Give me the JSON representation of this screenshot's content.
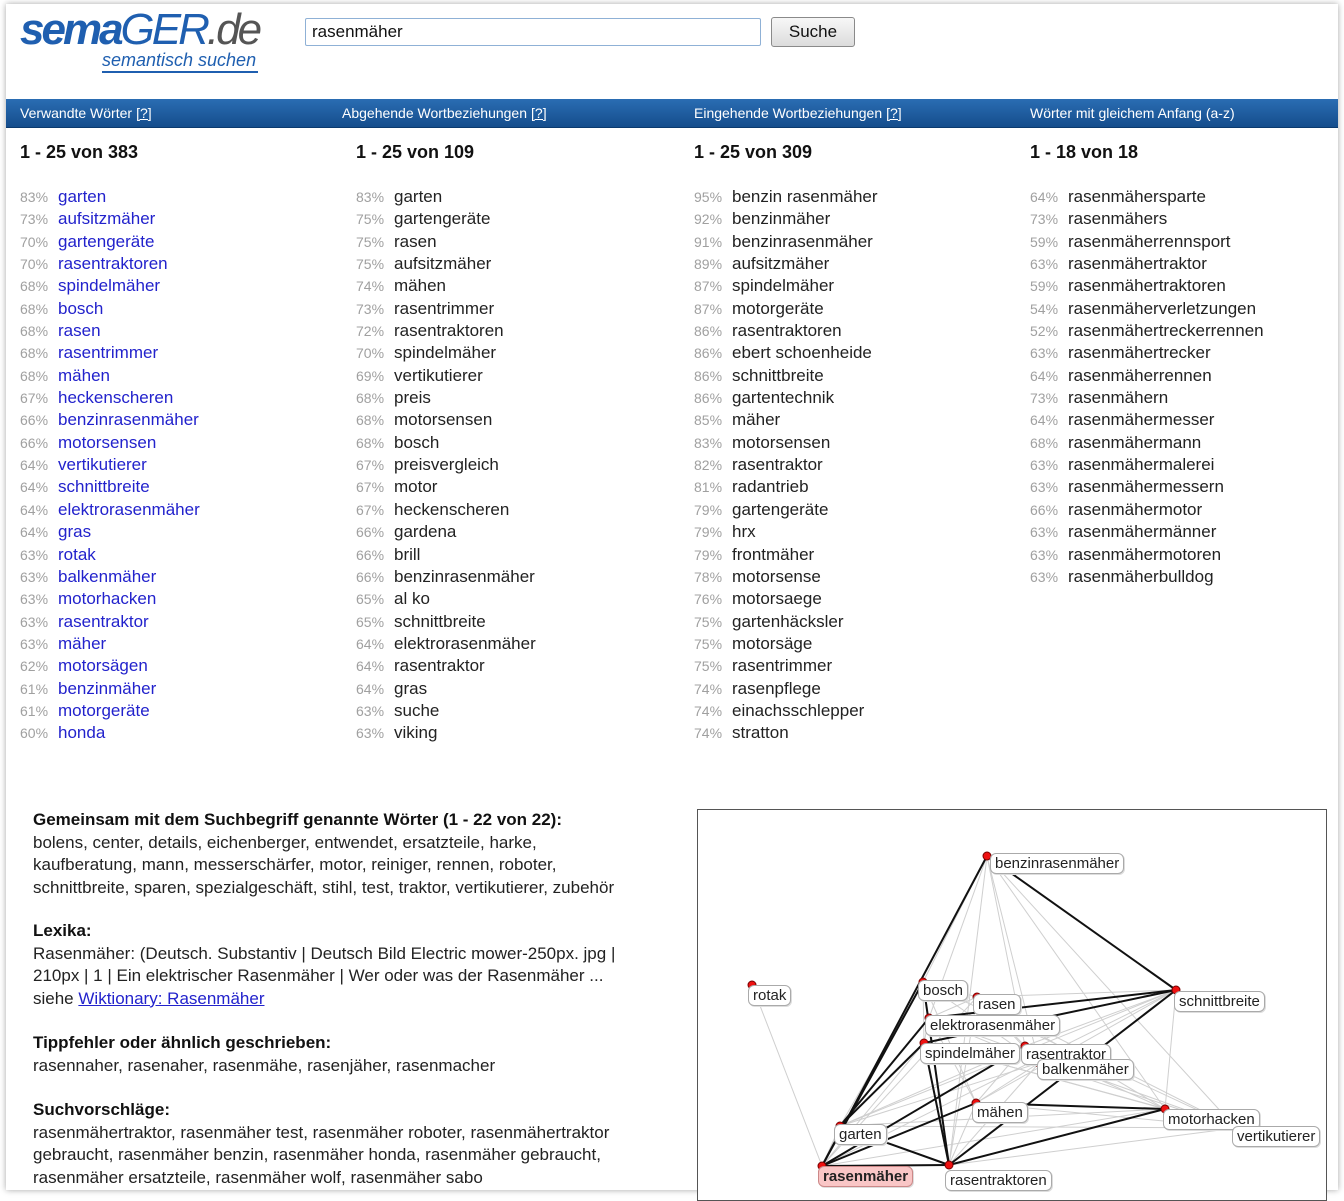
{
  "header": {
    "logo": {
      "sema": "sema",
      "ger": "GER",
      "de": ".de",
      "subtitle": "semantisch suchen"
    },
    "search_value": "rasenmäher",
    "search_button": "Suche"
  },
  "tabs": [
    {
      "label": "Verwandte Wörter",
      "help": "[?]"
    },
    {
      "label": "Abgehende Wortbeziehungen",
      "help": "[?]"
    },
    {
      "label": "Eingehende Wortbeziehungen",
      "help": "[?]"
    },
    {
      "label": "Wörter mit gleichem Anfang (a-z)",
      "help": ""
    }
  ],
  "columns": [
    {
      "count_label": "1 - 25 von 383",
      "items": [
        {
          "pct": "83%",
          "word": "garten"
        },
        {
          "pct": "73%",
          "word": "aufsitzmäher"
        },
        {
          "pct": "70%",
          "word": "gartengeräte"
        },
        {
          "pct": "70%",
          "word": "rasentraktoren"
        },
        {
          "pct": "68%",
          "word": "spindelmäher"
        },
        {
          "pct": "68%",
          "word": "bosch"
        },
        {
          "pct": "68%",
          "word": "rasen"
        },
        {
          "pct": "68%",
          "word": "rasentrimmer"
        },
        {
          "pct": "68%",
          "word": "mähen"
        },
        {
          "pct": "67%",
          "word": "heckenscheren"
        },
        {
          "pct": "66%",
          "word": "benzinrasenmäher"
        },
        {
          "pct": "66%",
          "word": "motorsensen"
        },
        {
          "pct": "64%",
          "word": "vertikutierer"
        },
        {
          "pct": "64%",
          "word": "schnittbreite"
        },
        {
          "pct": "64%",
          "word": "elektrorasenmäher"
        },
        {
          "pct": "64%",
          "word": "gras"
        },
        {
          "pct": "63%",
          "word": "rotak"
        },
        {
          "pct": "63%",
          "word": "balkenmäher"
        },
        {
          "pct": "63%",
          "word": "motorhacken"
        },
        {
          "pct": "63%",
          "word": "rasentraktor"
        },
        {
          "pct": "63%",
          "word": "mäher"
        },
        {
          "pct": "62%",
          "word": "motorsägen"
        },
        {
          "pct": "61%",
          "word": "benzinmäher"
        },
        {
          "pct": "61%",
          "word": "motorgeräte"
        },
        {
          "pct": "60%",
          "word": "honda"
        }
      ]
    },
    {
      "count_label": "1 - 25 von 109",
      "items": [
        {
          "pct": "83%",
          "word": "garten"
        },
        {
          "pct": "75%",
          "word": "gartengeräte"
        },
        {
          "pct": "75%",
          "word": "rasen"
        },
        {
          "pct": "75%",
          "word": "aufsitzmäher"
        },
        {
          "pct": "74%",
          "word": "mähen"
        },
        {
          "pct": "73%",
          "word": "rasentrimmer"
        },
        {
          "pct": "72%",
          "word": "rasentraktoren"
        },
        {
          "pct": "70%",
          "word": "spindelmäher"
        },
        {
          "pct": "69%",
          "word": "vertikutierer"
        },
        {
          "pct": "68%",
          "word": "preis"
        },
        {
          "pct": "68%",
          "word": "motorsensen"
        },
        {
          "pct": "68%",
          "word": "bosch"
        },
        {
          "pct": "67%",
          "word": "preisvergleich"
        },
        {
          "pct": "67%",
          "word": "motor"
        },
        {
          "pct": "67%",
          "word": "heckenscheren"
        },
        {
          "pct": "66%",
          "word": "gardena"
        },
        {
          "pct": "66%",
          "word": "brill"
        },
        {
          "pct": "66%",
          "word": "benzinrasenmäher"
        },
        {
          "pct": "65%",
          "word": "al ko"
        },
        {
          "pct": "65%",
          "word": "schnittbreite"
        },
        {
          "pct": "64%",
          "word": "elektrorasenmäher"
        },
        {
          "pct": "64%",
          "word": "rasentraktor"
        },
        {
          "pct": "64%",
          "word": "gras"
        },
        {
          "pct": "63%",
          "word": "suche"
        },
        {
          "pct": "63%",
          "word": "viking"
        }
      ]
    },
    {
      "count_label": "1 - 25 von 309",
      "items": [
        {
          "pct": "95%",
          "word": "benzin rasenmäher"
        },
        {
          "pct": "92%",
          "word": "benzinmäher"
        },
        {
          "pct": "91%",
          "word": "benzinrasenmäher"
        },
        {
          "pct": "89%",
          "word": "aufsitzmäher"
        },
        {
          "pct": "87%",
          "word": "spindelmäher"
        },
        {
          "pct": "87%",
          "word": "motorgeräte"
        },
        {
          "pct": "86%",
          "word": "rasentraktoren"
        },
        {
          "pct": "86%",
          "word": "ebert schoenheide"
        },
        {
          "pct": "86%",
          "word": "schnittbreite"
        },
        {
          "pct": "86%",
          "word": "gartentechnik"
        },
        {
          "pct": "85%",
          "word": "mäher"
        },
        {
          "pct": "83%",
          "word": "motorsensen"
        },
        {
          "pct": "82%",
          "word": "rasentraktor"
        },
        {
          "pct": "81%",
          "word": "radantrieb"
        },
        {
          "pct": "79%",
          "word": "gartengeräte"
        },
        {
          "pct": "79%",
          "word": "hrx"
        },
        {
          "pct": "79%",
          "word": "frontmäher"
        },
        {
          "pct": "78%",
          "word": "motorsense"
        },
        {
          "pct": "76%",
          "word": "motorsaege"
        },
        {
          "pct": "75%",
          "word": "gartenhäcksler"
        },
        {
          "pct": "75%",
          "word": "motorsäge"
        },
        {
          "pct": "75%",
          "word": "rasentrimmer"
        },
        {
          "pct": "74%",
          "word": "rasenpflege"
        },
        {
          "pct": "74%",
          "word": "einachsschlepper"
        },
        {
          "pct": "74%",
          "word": "stratton"
        }
      ]
    },
    {
      "count_label": "1 - 18 von 18",
      "items": [
        {
          "pct": "64%",
          "word": "rasenmähersparte"
        },
        {
          "pct": "73%",
          "word": "rasenmähers"
        },
        {
          "pct": "59%",
          "word": "rasenmäherrennsport"
        },
        {
          "pct": "63%",
          "word": "rasenmähertraktor"
        },
        {
          "pct": "59%",
          "word": "rasenmähertraktoren"
        },
        {
          "pct": "54%",
          "word": "rasenmäherverletzungen"
        },
        {
          "pct": "52%",
          "word": "rasenmähertreckerrennen"
        },
        {
          "pct": "63%",
          "word": "rasenmähertrecker"
        },
        {
          "pct": "64%",
          "word": "rasenmäherrennen"
        },
        {
          "pct": "73%",
          "word": "rasenmähern"
        },
        {
          "pct": "64%",
          "word": "rasenmähermesser"
        },
        {
          "pct": "68%",
          "word": "rasenmähermann"
        },
        {
          "pct": "63%",
          "word": "rasenmähermalerei"
        },
        {
          "pct": "63%",
          "word": "rasenmähermessern"
        },
        {
          "pct": "66%",
          "word": "rasenmähermotor"
        },
        {
          "pct": "63%",
          "word": "rasenmähermänner"
        },
        {
          "pct": "63%",
          "word": "rasenmähermotoren"
        },
        {
          "pct": "63%",
          "word": "rasenmäherbulldog"
        }
      ]
    }
  ],
  "common": {
    "heading": "Gemeinsam mit dem Suchbegriff genannte Wörter  (1 - 22 von 22):",
    "lines": [
      "bolens, center, details, eichenberger, entwendet, ersatzteile, harke,",
      "kaufberatung, mann, messerschärfer, motor, reiniger, rennen, roboter,",
      "schnittbreite, sparen, spezialgeschäft, stihl, test, traktor, vertikutierer, zubehör"
    ]
  },
  "lexika": {
    "heading": "Lexika:",
    "lines": [
      "Rasenmäher: (Deutsch. Substantiv | Deutsch Bild Electric mower-250px. jpg |",
      "210px | 1 | Ein elektrischer Rasenmäher | Wer oder was der Rasenmäher ..."
    ],
    "see_prefix": "siehe ",
    "link": "Wiktionary: Rasenmäher"
  },
  "typos": {
    "heading": "Tippfehler oder ähnlich geschrieben:",
    "text": "rasennaher, rasenaher, rasenmähe, rasenjäher, rasenmacher"
  },
  "suggestions": {
    "heading": "Suchvorschläge:",
    "lines": [
      "rasenmähertraktor, rasenmäher test, rasenmäher roboter, rasenmähertraktor",
      "gebraucht, rasenmäher benzin, rasenmäher honda, rasenmäher gebraucht,",
      "rasenmäher ersatzteile, rasenmäher wolf, rasenmäher sabo"
    ]
  },
  "graph": {
    "nodes": [
      {
        "id": "benzinrasenmaeher",
        "label": "benzinrasenmäher"
      },
      {
        "id": "rotak",
        "label": "rotak"
      },
      {
        "id": "bosch",
        "label": "bosch"
      },
      {
        "id": "rasen",
        "label": "rasen"
      },
      {
        "id": "schnittbreite",
        "label": "schnittbreite"
      },
      {
        "id": "elektrorasenmaeher",
        "label": "elektrorasenmäher"
      },
      {
        "id": "spindelmaeher",
        "label": "spindelmäher"
      },
      {
        "id": "rasentraktor",
        "label": "rasentraktor"
      },
      {
        "id": "balkenmaeher",
        "label": "balkenmäher"
      },
      {
        "id": "maehen",
        "label": "mähen"
      },
      {
        "id": "motorhacken",
        "label": "motorhacken"
      },
      {
        "id": "vertikutierer",
        "label": "vertikutierer"
      },
      {
        "id": "garten",
        "label": "garten"
      },
      {
        "id": "rasenmaeher",
        "label": "rasenmäher",
        "center": true
      },
      {
        "id": "rasentraktoren",
        "label": "rasentraktoren"
      }
    ]
  }
}
